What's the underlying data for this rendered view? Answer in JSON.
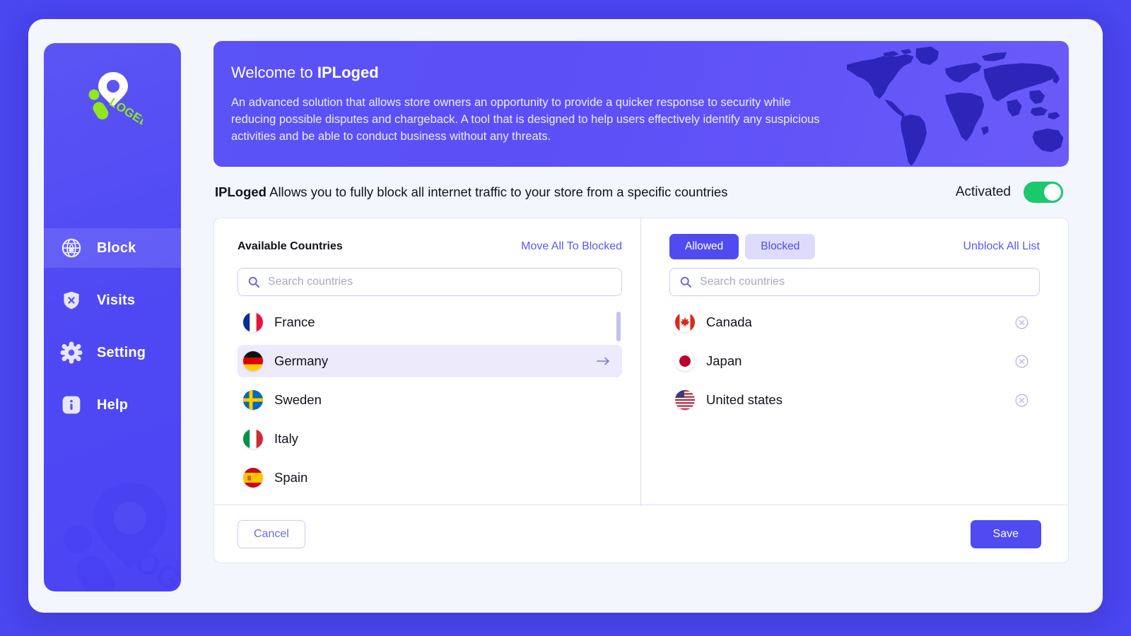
{
  "theme": {
    "page_bg": "#4a46f0",
    "accent": "#4f4bf1",
    "accent_light": "#dedcfb",
    "toggle_on": "#19c96b",
    "sidebar_gradient_from": "#5b55f5",
    "sidebar_gradient_to": "#4a44f3",
    "map_fill": "#2a23b5"
  },
  "sidebar": {
    "logo_text": "LOGED",
    "items": [
      {
        "label": "Block",
        "icon": "globe-lock-icon",
        "active": true
      },
      {
        "label": "Visits",
        "icon": "shield-x-icon",
        "active": false
      },
      {
        "label": "Setting",
        "icon": "gear-icon",
        "active": false
      },
      {
        "label": "Help",
        "icon": "info-icon",
        "active": false
      }
    ]
  },
  "banner": {
    "title_prefix": "Welcome to ",
    "title_brand": "IPLoged",
    "description": "An advanced solution that allows store owners an opportunity to provide a quicker response to security while reducing possible disputes and chargeback. A tool that is designed to help users effectively identify any suspicious activities and be able to conduct business without any threats.",
    "art": "world-map"
  },
  "subtitle": {
    "brand": "IPLoged",
    "text": " Allows you to fully block all internet traffic to your store from a specific countries",
    "activate_label": "Activated",
    "activated": true
  },
  "available": {
    "title": "Available Countries",
    "move_all_label": "Move All To Blocked",
    "search_placeholder": "Search countries",
    "search_value": "",
    "countries": [
      {
        "name": "France",
        "flag": "fr",
        "hovered": false
      },
      {
        "name": "Germany",
        "flag": "de",
        "hovered": true
      },
      {
        "name": "Sweden",
        "flag": "se",
        "hovered": false
      },
      {
        "name": "Italy",
        "flag": "it",
        "hovered": false
      },
      {
        "name": "Spain",
        "flag": "es",
        "hovered": false
      }
    ],
    "scroll_thumb_pct": 8
  },
  "selected": {
    "tabs": [
      {
        "label": "Allowed",
        "active": true
      },
      {
        "label": "Blocked",
        "active": false
      }
    ],
    "unblock_all_label": "Unblock All List",
    "search_placeholder": "Search countries",
    "search_value": "",
    "countries": [
      {
        "name": "Canada",
        "flag": "ca"
      },
      {
        "name": "Japan",
        "flag": "jp"
      },
      {
        "name": "United states",
        "flag": "us"
      }
    ]
  },
  "footer": {
    "cancel_label": "Cancel",
    "save_label": "Save"
  }
}
